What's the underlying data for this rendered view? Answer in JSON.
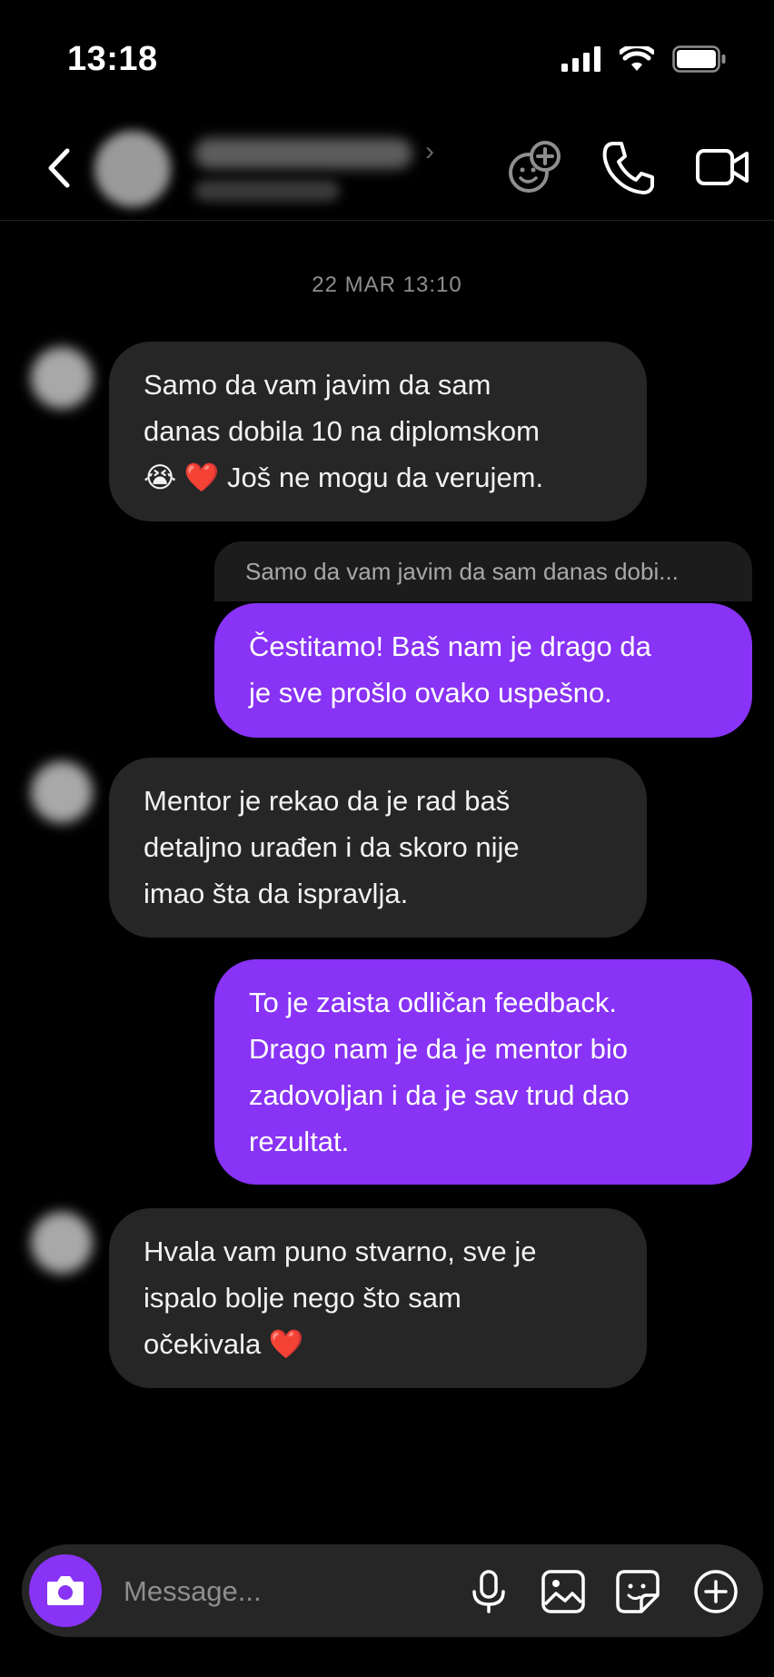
{
  "status_bar": {
    "time": "13:18",
    "icons": [
      "cellular-signal-icon",
      "wifi-icon",
      "battery-icon"
    ]
  },
  "header": {
    "contact_name": "",
    "contact_subtitle": "",
    "icons": [
      "back-chevron-icon",
      "chevron-right-icon",
      "add-people-icon",
      "phone-icon",
      "video-camera-icon"
    ]
  },
  "conversation": {
    "timestamp": "22 MAR 13:10",
    "messages": [
      {
        "side": "in",
        "lines": [
          "Samo da vam javim da sam",
          "danas dobila 10 na diplomskom",
          "😭 ❤️  Još ne mogu da verujem."
        ]
      },
      {
        "side": "out",
        "reply_preview": "Samo da vam javim da sam danas dobi...",
        "lines": [
          "Čestitamo! Baš nam je drago da",
          "je sve prošlo ovako uspešno."
        ]
      },
      {
        "side": "in",
        "lines": [
          "Mentor je rekao da je rad baš",
          "detaljno urađen i da skoro nije",
          "imao šta da ispravlja."
        ]
      },
      {
        "side": "out",
        "lines": [
          "To je zaista odličan feedback.",
          "Drago nam je da je mentor bio",
          "zadovoljan i da je sav trud dao",
          "rezultat."
        ]
      },
      {
        "side": "in",
        "lines": [
          "Hvala vam puno stvarno, sve je",
          "ispalo bolje nego što sam",
          "očekivala ❤️"
        ]
      }
    ]
  },
  "composer": {
    "placeholder": "Message...",
    "value": "",
    "icons": [
      "camera-icon",
      "microphone-icon",
      "gallery-icon",
      "sticker-icon",
      "plus-circle-icon"
    ]
  },
  "colors": {
    "background": "#000000",
    "incoming_bubble": "#262626",
    "outgoing_bubble": "#8833f5",
    "secondary_text": "#8e8e8e"
  }
}
